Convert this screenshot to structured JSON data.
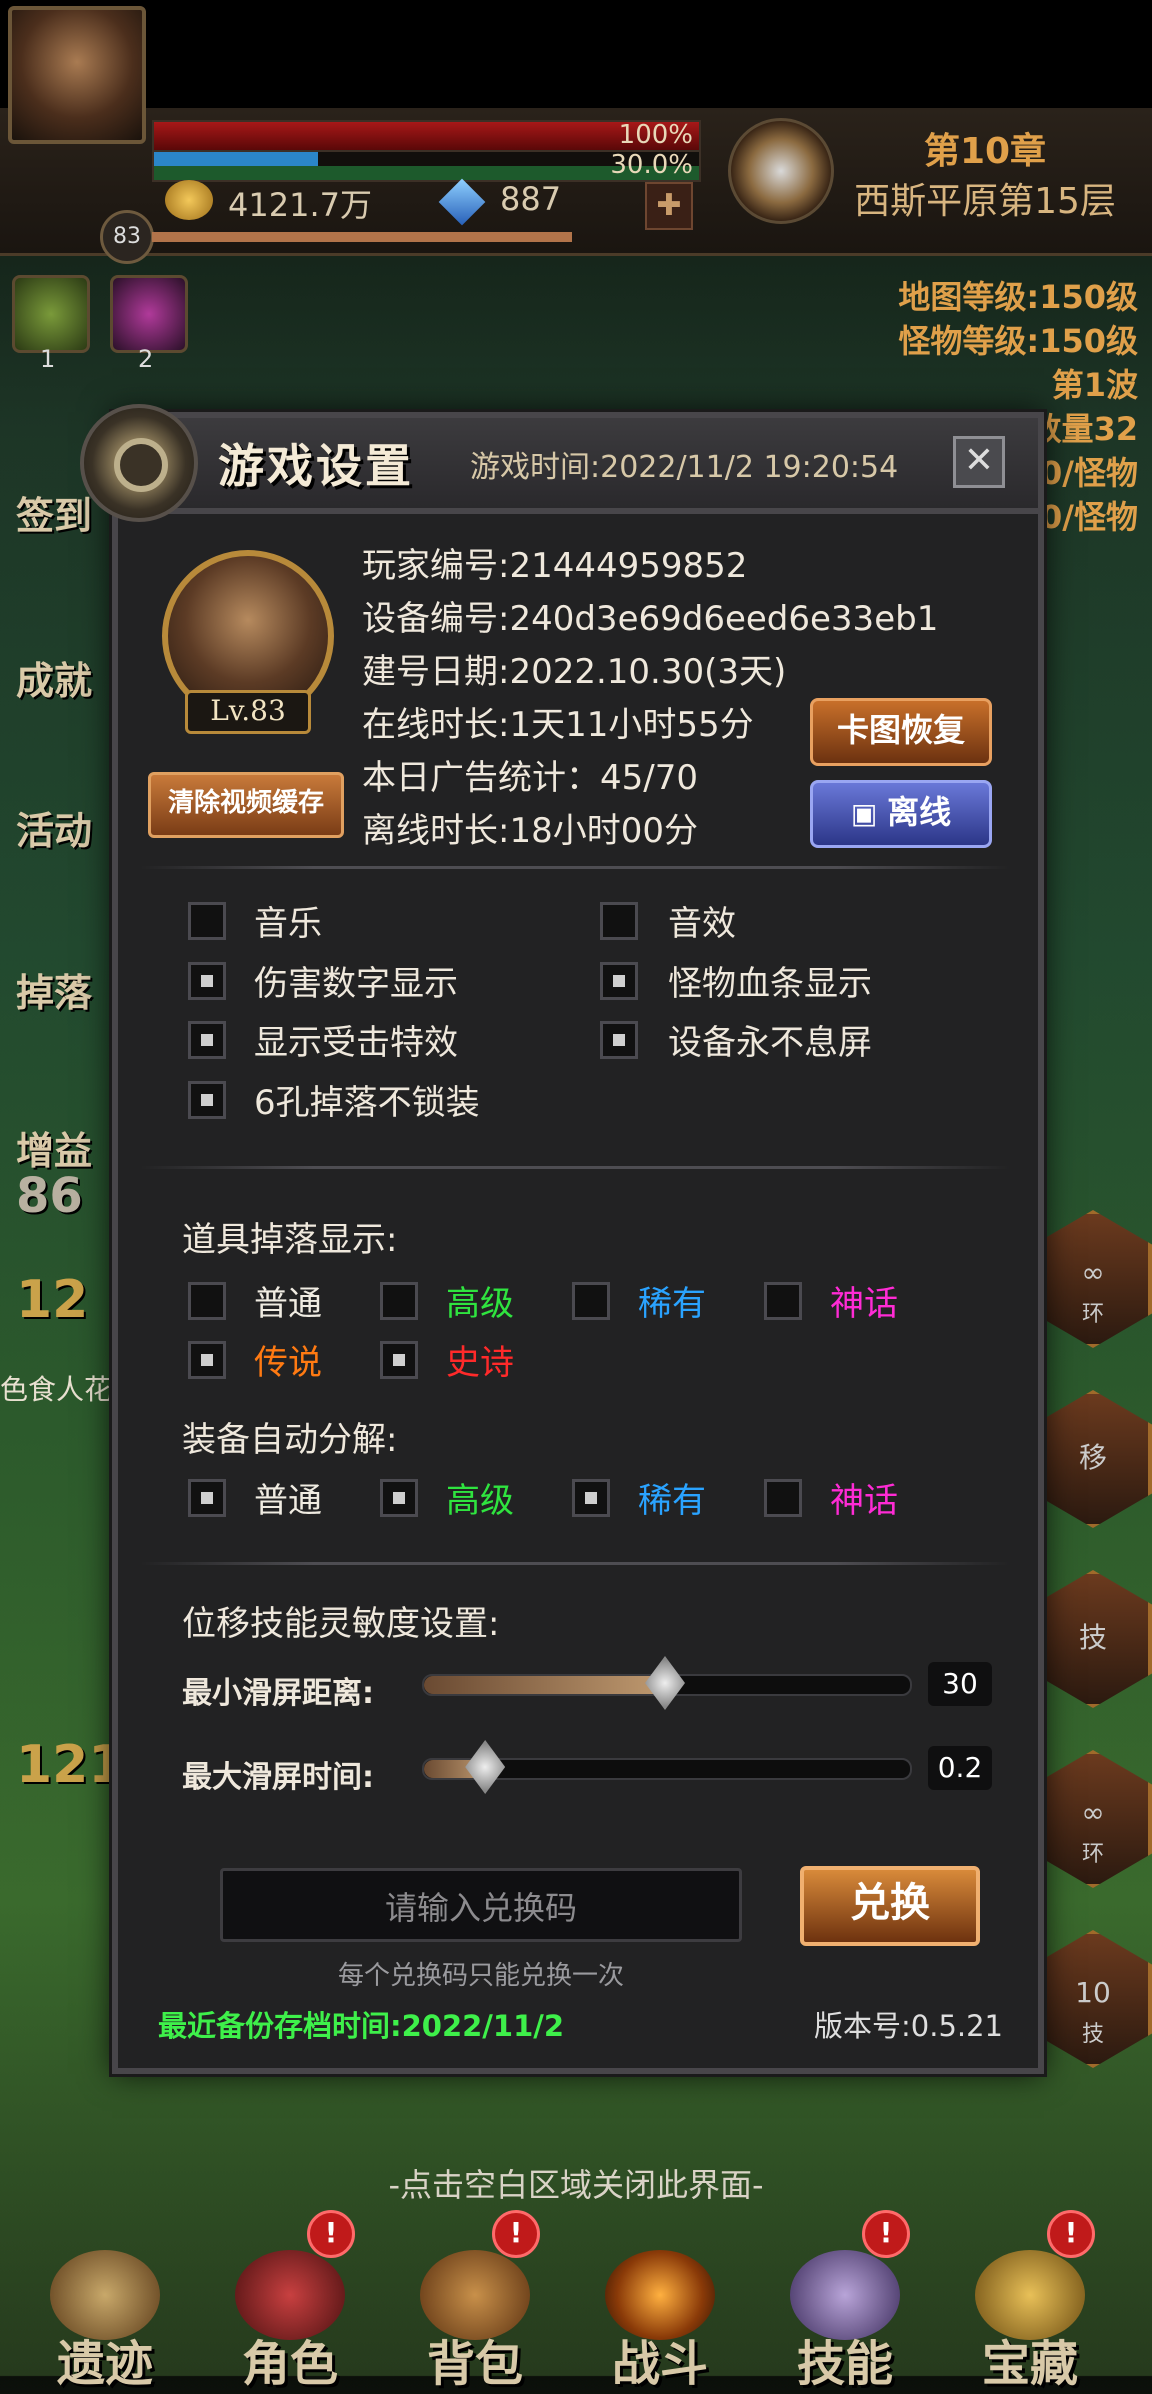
{
  "hud": {
    "player_level": "83",
    "hp_percent_label": "100%",
    "mp_percent_label": "30.0%",
    "gold": "4121.7万",
    "gems": "887",
    "chapter": "第10章",
    "stage": "西斯平原第15层",
    "buff1_count": "1",
    "buff2_count": "2"
  },
  "right_info": {
    "map_level": "地图等级:150级",
    "monster_level": "怪物等级:150级",
    "wave": "第1波",
    "count": "数量32",
    "monsters_line1": "0/怪物",
    "monsters_line2": "0/怪物"
  },
  "left_menu": {
    "signin": "签到",
    "achievement": "成就",
    "activity": "活动",
    "drop": "掉落",
    "buff": "增益",
    "buff_num": "86",
    "num1": "12",
    "mob_name": "色食人花",
    "num2": "121"
  },
  "right_skills": [
    "∞",
    "移",
    "技",
    "∞",
    "10"
  ],
  "right_skill_sub": [
    "环",
    "",
    "",
    "环",
    "技"
  ],
  "modal": {
    "title": "游戏设置",
    "game_time": "游戏时间:2022/11/2 19:20:54",
    "avatar_level": "Lv.83",
    "clear_cache_button": "清除视频缓存",
    "player_id": "玩家编号:21444959852",
    "device_id": "设备编号:240d3e69d6eed6e33eb1",
    "created": "建号日期:2022.10.30(3天)",
    "online": "在线时长:1天11小时55分",
    "ads": "本日广告统计：45/70",
    "offline_time": "离线时长:18小时00分",
    "restore_button": "卡图恢复",
    "offline_button": "离线"
  },
  "toggles": [
    {
      "label": "音乐",
      "checked": false
    },
    {
      "label": "音效",
      "checked": false
    },
    {
      "label": "伤害数字显示",
      "checked": true
    },
    {
      "label": "怪物血条显示",
      "checked": true
    },
    {
      "label": "显示受击特效",
      "checked": true
    },
    {
      "label": "设备永不息屏",
      "checked": true
    },
    {
      "label": "6孔掉落不锁装",
      "checked": true
    }
  ],
  "drop_display": {
    "title": "道具掉落显示:",
    "items": [
      {
        "label": "普通",
        "checked": false,
        "color": "#f0ece2"
      },
      {
        "label": "高级",
        "checked": false,
        "color": "#2fe43f"
      },
      {
        "label": "稀有",
        "checked": false,
        "color": "#2aa3ff"
      },
      {
        "label": "神话",
        "checked": false,
        "color": "#ff2bd5"
      },
      {
        "label": "传说",
        "checked": true,
        "color": "#ff7a12"
      },
      {
        "label": "史诗",
        "checked": true,
        "color": "#ff2a2a"
      }
    ]
  },
  "auto_decompose": {
    "title": "装备自动分解:",
    "items": [
      {
        "label": "普通",
        "checked": true,
        "color": "#f0ece2"
      },
      {
        "label": "高级",
        "checked": true,
        "color": "#2fe43f"
      },
      {
        "label": "稀有",
        "checked": true,
        "color": "#2aa3ff"
      },
      {
        "label": "神话",
        "checked": false,
        "color": "#ff2bd5"
      }
    ]
  },
  "sensitivity": {
    "title": "位移技能灵敏度设置:",
    "min_distance_label": "最小滑屏距离:",
    "min_distance_value": "30",
    "min_distance_fraction": 0.5,
    "max_time_label": "最大滑屏时间:",
    "max_time_value": "0.2",
    "max_time_fraction": 0.13
  },
  "redeem": {
    "placeholder": "请输入兑换码",
    "button": "兑换",
    "hint": "每个兑换码只能兑换一次"
  },
  "footer": {
    "backup": "最近备份存档时间:2022/11/2",
    "version": "版本号:0.5.21"
  },
  "close_hint": "-点击空白区域关闭此界面-",
  "bottom_nav": [
    {
      "label": "遗迹",
      "badge": ""
    },
    {
      "label": "角色",
      "badge": "!"
    },
    {
      "label": "背包",
      "badge": "!"
    },
    {
      "label": "战斗",
      "badge": ""
    },
    {
      "label": "技能",
      "badge": "!"
    },
    {
      "label": "宝藏",
      "badge": "!"
    }
  ]
}
